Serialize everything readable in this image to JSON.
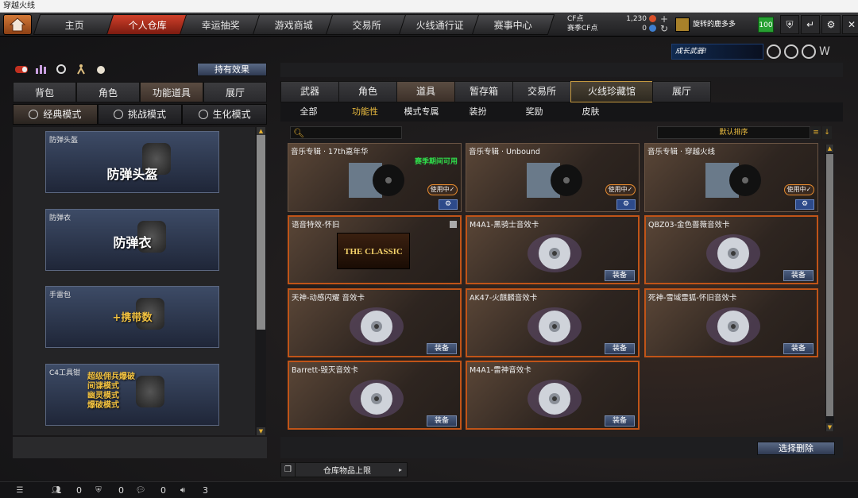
{
  "window": {
    "title": "穿越火线"
  },
  "nav": {
    "tabs": [
      {
        "label": "主页"
      },
      {
        "label": "个人仓库"
      },
      {
        "label": "幸运抽奖"
      },
      {
        "label": "游戏商城"
      },
      {
        "label": "交易所"
      },
      {
        "label": "火线通行证"
      },
      {
        "label": "赛事中心"
      }
    ],
    "active_tab": "个人仓库"
  },
  "currency": {
    "cf_label": "CF点",
    "cf_value": "1,230",
    "season_cf_label": "赛季CF点",
    "season_cf_value": "0"
  },
  "user": {
    "name": "旋转的鹿多多",
    "level": "100"
  },
  "left": {
    "effects_button": "持有效果",
    "tabs": [
      "背包",
      "角色",
      "功能道具",
      "展厅"
    ],
    "active_tab": "功能道具",
    "modes": [
      "经典模式",
      "挑战模式",
      "生化模式"
    ],
    "active_mode": "经典模式",
    "items": [
      {
        "label": "防弹头盔",
        "big": "防弹头盔"
      },
      {
        "label": "防弹衣",
        "big": "防弹衣"
      },
      {
        "label": "手雷包",
        "big": "+携带数"
      },
      {
        "label": "C4工具钳",
        "big": "超级佣兵爆破\n间谍模式\n幽灵模式\n爆破模式"
      }
    ]
  },
  "right": {
    "ad_text": "成长武器!",
    "tabs": [
      "武器",
      "角色",
      "道具",
      "暂存箱",
      "交易所",
      "火线珍藏馆",
      "展厅"
    ],
    "active_tab": "道具",
    "subtabs": [
      "全部",
      "功能性",
      "模式专属",
      "装扮",
      "奖励",
      "皮肤"
    ],
    "active_subtab": "功能性",
    "sort_label": "默认排序",
    "cards": [
      {
        "title": "音乐专辑 · 17th嘉年华",
        "state": "inuse",
        "season": "赛季期间可用",
        "inuse": "使用中✓"
      },
      {
        "title": "音乐专辑 · Unbound",
        "state": "inuse",
        "inuse": "使用中✓"
      },
      {
        "title": "音乐专辑 · 穿越火线",
        "state": "inuse",
        "inuse": "使用中✓"
      },
      {
        "title": "语音特效-怀旧",
        "state": "classic",
        "art_text": "THE CLASSIC"
      },
      {
        "title": "M4A1-黑骑士音效卡",
        "state": "equip",
        "equip": "装备"
      },
      {
        "title": "QBZ03-金色蔷薇音效卡",
        "state": "equip",
        "equip": "装备"
      },
      {
        "title": "天神-动感闪耀 音效卡",
        "state": "equip",
        "equip": "装备"
      },
      {
        "title": "AK47-火麒麟音效卡",
        "state": "equip",
        "equip": "装备"
      },
      {
        "title": "死神-雪域雷狐-怀旧音效卡",
        "state": "equip",
        "equip": "装备"
      },
      {
        "title": "Barrett-毁灭音效卡",
        "state": "equip",
        "equip": "装备"
      },
      {
        "title": "M4A1-雷神音效卡",
        "state": "equip",
        "equip": "装备"
      }
    ],
    "delete_button": "选择删除",
    "capacity_label": "仓库物品上限"
  },
  "status": {
    "friends": "0",
    "clan": "0",
    "chat": "0",
    "volume": "3"
  },
  "colors": {
    "accent": "#c05418",
    "active_tab": "#c0392b",
    "gold": "#f0c040"
  }
}
